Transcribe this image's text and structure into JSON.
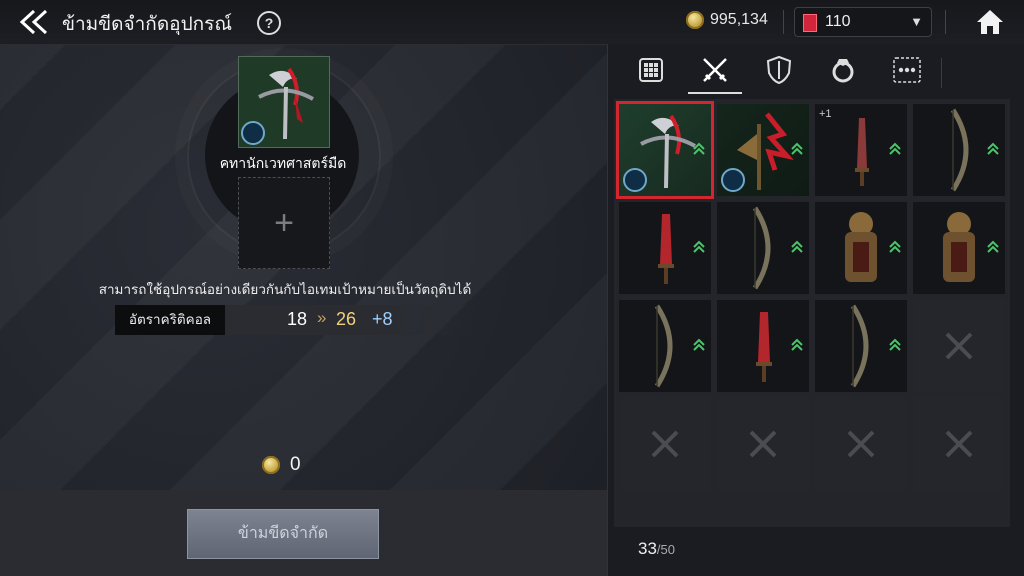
{
  "header": {
    "back_icon": "double-chevron-left-icon",
    "title": "ข้ามขีดจำกัดอุปกรณ์",
    "help_label": "?",
    "gold": "995,134",
    "gems": "110",
    "home_icon": "home-icon"
  },
  "left": {
    "item_name": "คทานักเวทศาสตร์มืด",
    "info": "สามารถใช้อุปกรณ์อย่างเดียวกันกับไอเทมเป้าหมายเป็นวัตถุดิบได้",
    "stat": {
      "label": "อัตราคริติคอล",
      "from": "18",
      "arrow": "»",
      "to": "26",
      "plus": "+8"
    },
    "cost": "0",
    "button_label": "ข้ามขีดจำกัด"
  },
  "tabs": [
    {
      "icon": "grid-icon",
      "active": false
    },
    {
      "icon": "crossed-swords-icon",
      "active": true
    },
    {
      "icon": "shield-icon",
      "active": false
    },
    {
      "icon": "ring-icon",
      "active": false
    },
    {
      "icon": "more-icon",
      "active": false
    }
  ],
  "inventory": {
    "count": "33",
    "max": "/50",
    "plus1": "+1"
  },
  "colors": {
    "accent": "#d4262f",
    "upgrade": "#4cc46b",
    "gold": "#f0d27a",
    "plus": "#9fd0ff"
  }
}
